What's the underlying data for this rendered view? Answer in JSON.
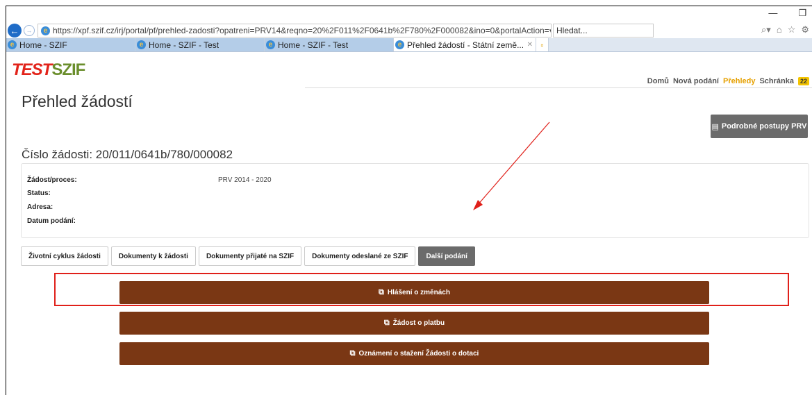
{
  "browser": {
    "url": "https://xpf.szif.cz/irj/portal/pf/prehled-zadosti?opatreni=PRV14&reqno=20%2F011%2F0641b%2F780%2F000082&ino=0&portalAction=",
    "search_placeholder": "Hledat...",
    "tabs": [
      {
        "label": "Home - SZIF",
        "active": false
      },
      {
        "label": "Home - SZIF - Test",
        "active": false
      },
      {
        "label": "Home - SZIF - Test",
        "active": false
      },
      {
        "label": "Přehled žádostí - Státní země...",
        "active": true
      }
    ],
    "minimize": "—",
    "restore": "❐"
  },
  "header": {
    "logo_test": "TEST",
    "logo_szif": "SZIF",
    "nav": [
      {
        "label": "Domů",
        "active": false
      },
      {
        "label": "Nová podání",
        "active": false
      },
      {
        "label": "Přehledy",
        "active": true
      },
      {
        "label": "Schránka",
        "active": false
      }
    ],
    "inbox_count": "22"
  },
  "page": {
    "title": "Přehled žádostí",
    "postupy_button": "Podrobné postupy PRV",
    "request_number": "Číslo žádosti: 20/011/0641b/780/000082"
  },
  "info": {
    "rows": [
      {
        "label": "Žádost/proces:",
        "value": "PRV 2014 - 2020"
      },
      {
        "label": "Status:",
        "value": ""
      },
      {
        "label": "Adresa:",
        "value": ""
      },
      {
        "label": "Datum podání:",
        "value": ""
      }
    ]
  },
  "tabs": [
    {
      "label": "Životní cyklus žádosti",
      "active": false
    },
    {
      "label": "Dokumenty k žádosti",
      "active": false
    },
    {
      "label": "Dokumenty přijaté na SZIF",
      "active": false
    },
    {
      "label": "Dokumenty odeslané ze SZIF",
      "active": false
    },
    {
      "label": "Další podání",
      "active": true
    }
  ],
  "actions": [
    {
      "label": "Hlášení o změnách"
    },
    {
      "label": "Žádost o platbu"
    },
    {
      "label": "Oznámení o stažení Žádosti o dotaci"
    }
  ],
  "colors": {
    "action_button": "#7a3714",
    "active_nav": "#e6a000",
    "highlight": "#e0201a"
  }
}
